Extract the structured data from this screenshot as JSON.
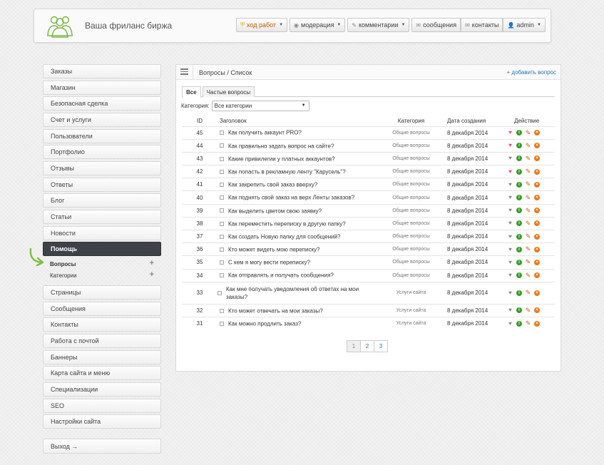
{
  "header": {
    "site_title": "Ваша фриланс биржа",
    "nav": [
      {
        "label": "ход работ",
        "icon": "shield-icon",
        "dropdown": true,
        "highlight": true
      },
      {
        "label": "модерация",
        "icon": "eye-icon",
        "dropdown": true
      },
      {
        "label": "комментарии",
        "icon": "pencil-icon",
        "dropdown": true
      },
      {
        "label": "сообщения",
        "icon": "envelope-icon",
        "dropdown": false
      },
      {
        "label": "контакты",
        "icon": "envelope-icon",
        "dropdown": false
      },
      {
        "label": "admin",
        "icon": "user-icon",
        "dropdown": true
      }
    ]
  },
  "sidebar": {
    "items_top": [
      "Заказы",
      "Магазин",
      "Безопасная сделка",
      "Счет и услуги",
      "Пользователи",
      "Портфолио",
      "Отзывы",
      "Ответы",
      "Блог",
      "Статьи",
      "Новости"
    ],
    "active": "Помощь",
    "subitems": [
      {
        "label": "Вопросы",
        "bold": true
      },
      {
        "label": "Категории",
        "bold": false
      }
    ],
    "items_bottom": [
      "Страницы",
      "Сообщения",
      "Контакты",
      "Работа с почтой",
      "Баннеры",
      "Карта сайта и меню",
      "Специализации",
      "SEO",
      "Настройки сайта"
    ],
    "logout": "Выход →"
  },
  "main": {
    "breadcrumb": "Вопросы / Список",
    "add_link": "+ добавить вопрос",
    "tabs": [
      {
        "label": "Все",
        "active": true
      },
      {
        "label": "Частые вопросы",
        "active": false
      }
    ],
    "filter": {
      "label": "Категория:",
      "value": "Все категории"
    },
    "columns": [
      "ID",
      "Заголовок",
      "Категория",
      "Дата создания",
      "Действие"
    ],
    "rows": [
      {
        "id": "45",
        "title": "Как получить аккаунт PRO?",
        "category": "Общие вопросы",
        "date": "8 декабря 2014",
        "fav": true
      },
      {
        "id": "44",
        "title": "Как правильно задать вопрос на сайте?",
        "category": "Общие вопросы",
        "date": "8 декабря 2014",
        "fav": true
      },
      {
        "id": "43",
        "title": "Какие привилегии у платных аккаунтов?",
        "category": "Общие вопросы",
        "date": "8 декабря 2014",
        "fav": false
      },
      {
        "id": "42",
        "title": "Как попасть в рекламную ленту \"Карусель\"?",
        "category": "Общие вопросы",
        "date": "8 декабря 2014",
        "fav": true
      },
      {
        "id": "41",
        "title": "Как закрепить свой заказ вверху?",
        "category": "Общие вопросы",
        "date": "8 декабря 2014",
        "fav": false
      },
      {
        "id": "40",
        "title": "Как поднять свой заказ на верх Ленты заказов?",
        "category": "Общие вопросы",
        "date": "8 декабря 2014",
        "fav": false
      },
      {
        "id": "39",
        "title": "Как выделить цветом свою заявку?",
        "category": "Общие вопросы",
        "date": "8 декабря 2014",
        "fav": false
      },
      {
        "id": "38",
        "title": "Как переместить переписку в другую папку?",
        "category": "Общие вопросы",
        "date": "8 декабря 2014",
        "fav": false
      },
      {
        "id": "37",
        "title": "Как создать Новую папку для сообщений?",
        "category": "Общие вопросы",
        "date": "8 декабря 2014",
        "fav": false
      },
      {
        "id": "36",
        "title": "Кто может видеть мою переписку?",
        "category": "Общие вопросы",
        "date": "8 декабря 2014",
        "fav": false
      },
      {
        "id": "35",
        "title": "С кем я могу вести переписку?",
        "category": "Общие вопросы",
        "date": "8 декабря 2014",
        "fav": false
      },
      {
        "id": "34",
        "title": "Как отправлять и получать сообщения?",
        "category": "Общие вопросы",
        "date": "8 декабря 2014",
        "fav": false
      },
      {
        "id": "33",
        "title": "Как мне получать уведомления об ответах на мои заказы?",
        "category": "Услуги сайта",
        "date": "8 декабря 2014",
        "fav": false,
        "tall": true
      },
      {
        "id": "32",
        "title": "Кто может отвечать на мои заказы?",
        "category": "Услуги сайта",
        "date": "8 декабря 2014",
        "fav": false
      },
      {
        "id": "31",
        "title": "Как можно продлить заказ?",
        "category": "Услуги сайта",
        "date": "8 декабря 2014",
        "fav": false
      }
    ],
    "pagination": {
      "pages": [
        "1",
        "2",
        "3"
      ],
      "current": "1"
    }
  },
  "colors": {
    "accent": "#2a72b5",
    "active_nav": "#3d4148",
    "fav": "#e84a8c",
    "arrow": "#7cc043"
  }
}
